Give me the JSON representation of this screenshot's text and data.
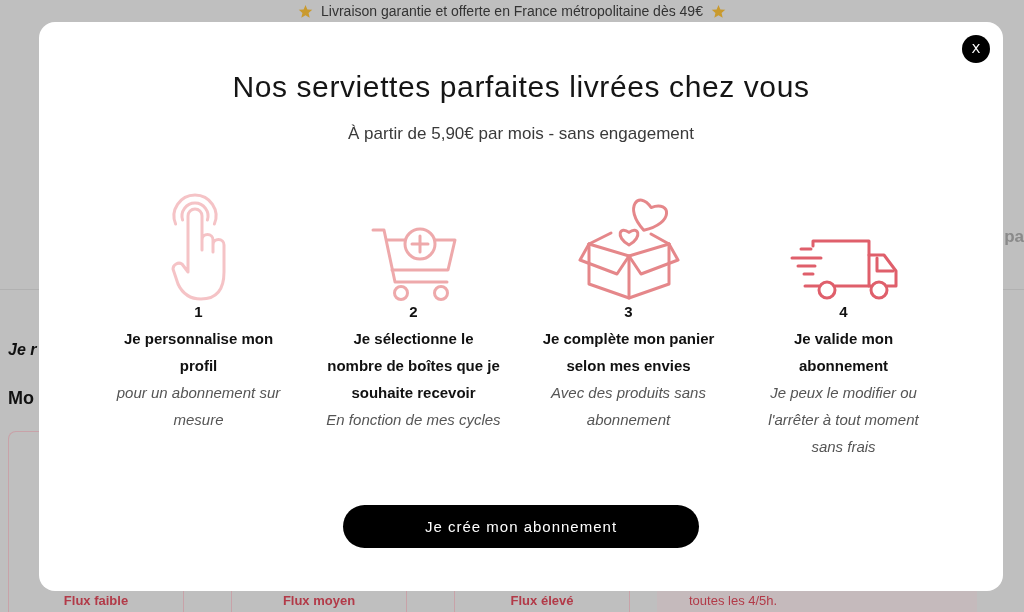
{
  "background_page": {
    "banner": {
      "text": "Livraison garantie et offerte en France métropolitaine dès 49€"
    },
    "header_fragment": "pa",
    "section_heading_fragment": "Je r",
    "subsection_heading_fragment": "Mo",
    "cards": [
      {
        "kind": "option",
        "label": "Flux faible"
      },
      {
        "kind": "option",
        "label": "Flux moyen"
      },
      {
        "kind": "option",
        "label": "Flux élevé"
      },
      {
        "kind": "note",
        "label": "toutes les 4/5h."
      }
    ]
  },
  "modal": {
    "close_label": "X",
    "title": "Nos serviettes parfaites livrées chez vous",
    "subtitle": "À partir de 5,90€ par mois - sans engagement",
    "steps": [
      {
        "kind": "tap",
        "color": "#f5c3c6",
        "number": "1",
        "title": "Je personnalise mon profil",
        "description": "pour un abonnement sur mesure"
      },
      {
        "kind": "cart",
        "color": "#eea9ab",
        "number": "2",
        "title": "Je sélectionne le nombre de boîtes que je souhaite recevoir",
        "description": "En fonction de mes cycles"
      },
      {
        "kind": "box",
        "color": "#e5878a",
        "number": "3",
        "title": "Je complète mon panier selon mes envies",
        "description": "Avec des produits sans abonnement"
      },
      {
        "kind": "truck",
        "color": "#df5f6b",
        "number": "4",
        "title": "Je valide mon abonnement",
        "description": "Je peux le modifier ou l'arrêter à tout moment sans frais"
      }
    ],
    "cta": "Je crée mon abonnement"
  }
}
